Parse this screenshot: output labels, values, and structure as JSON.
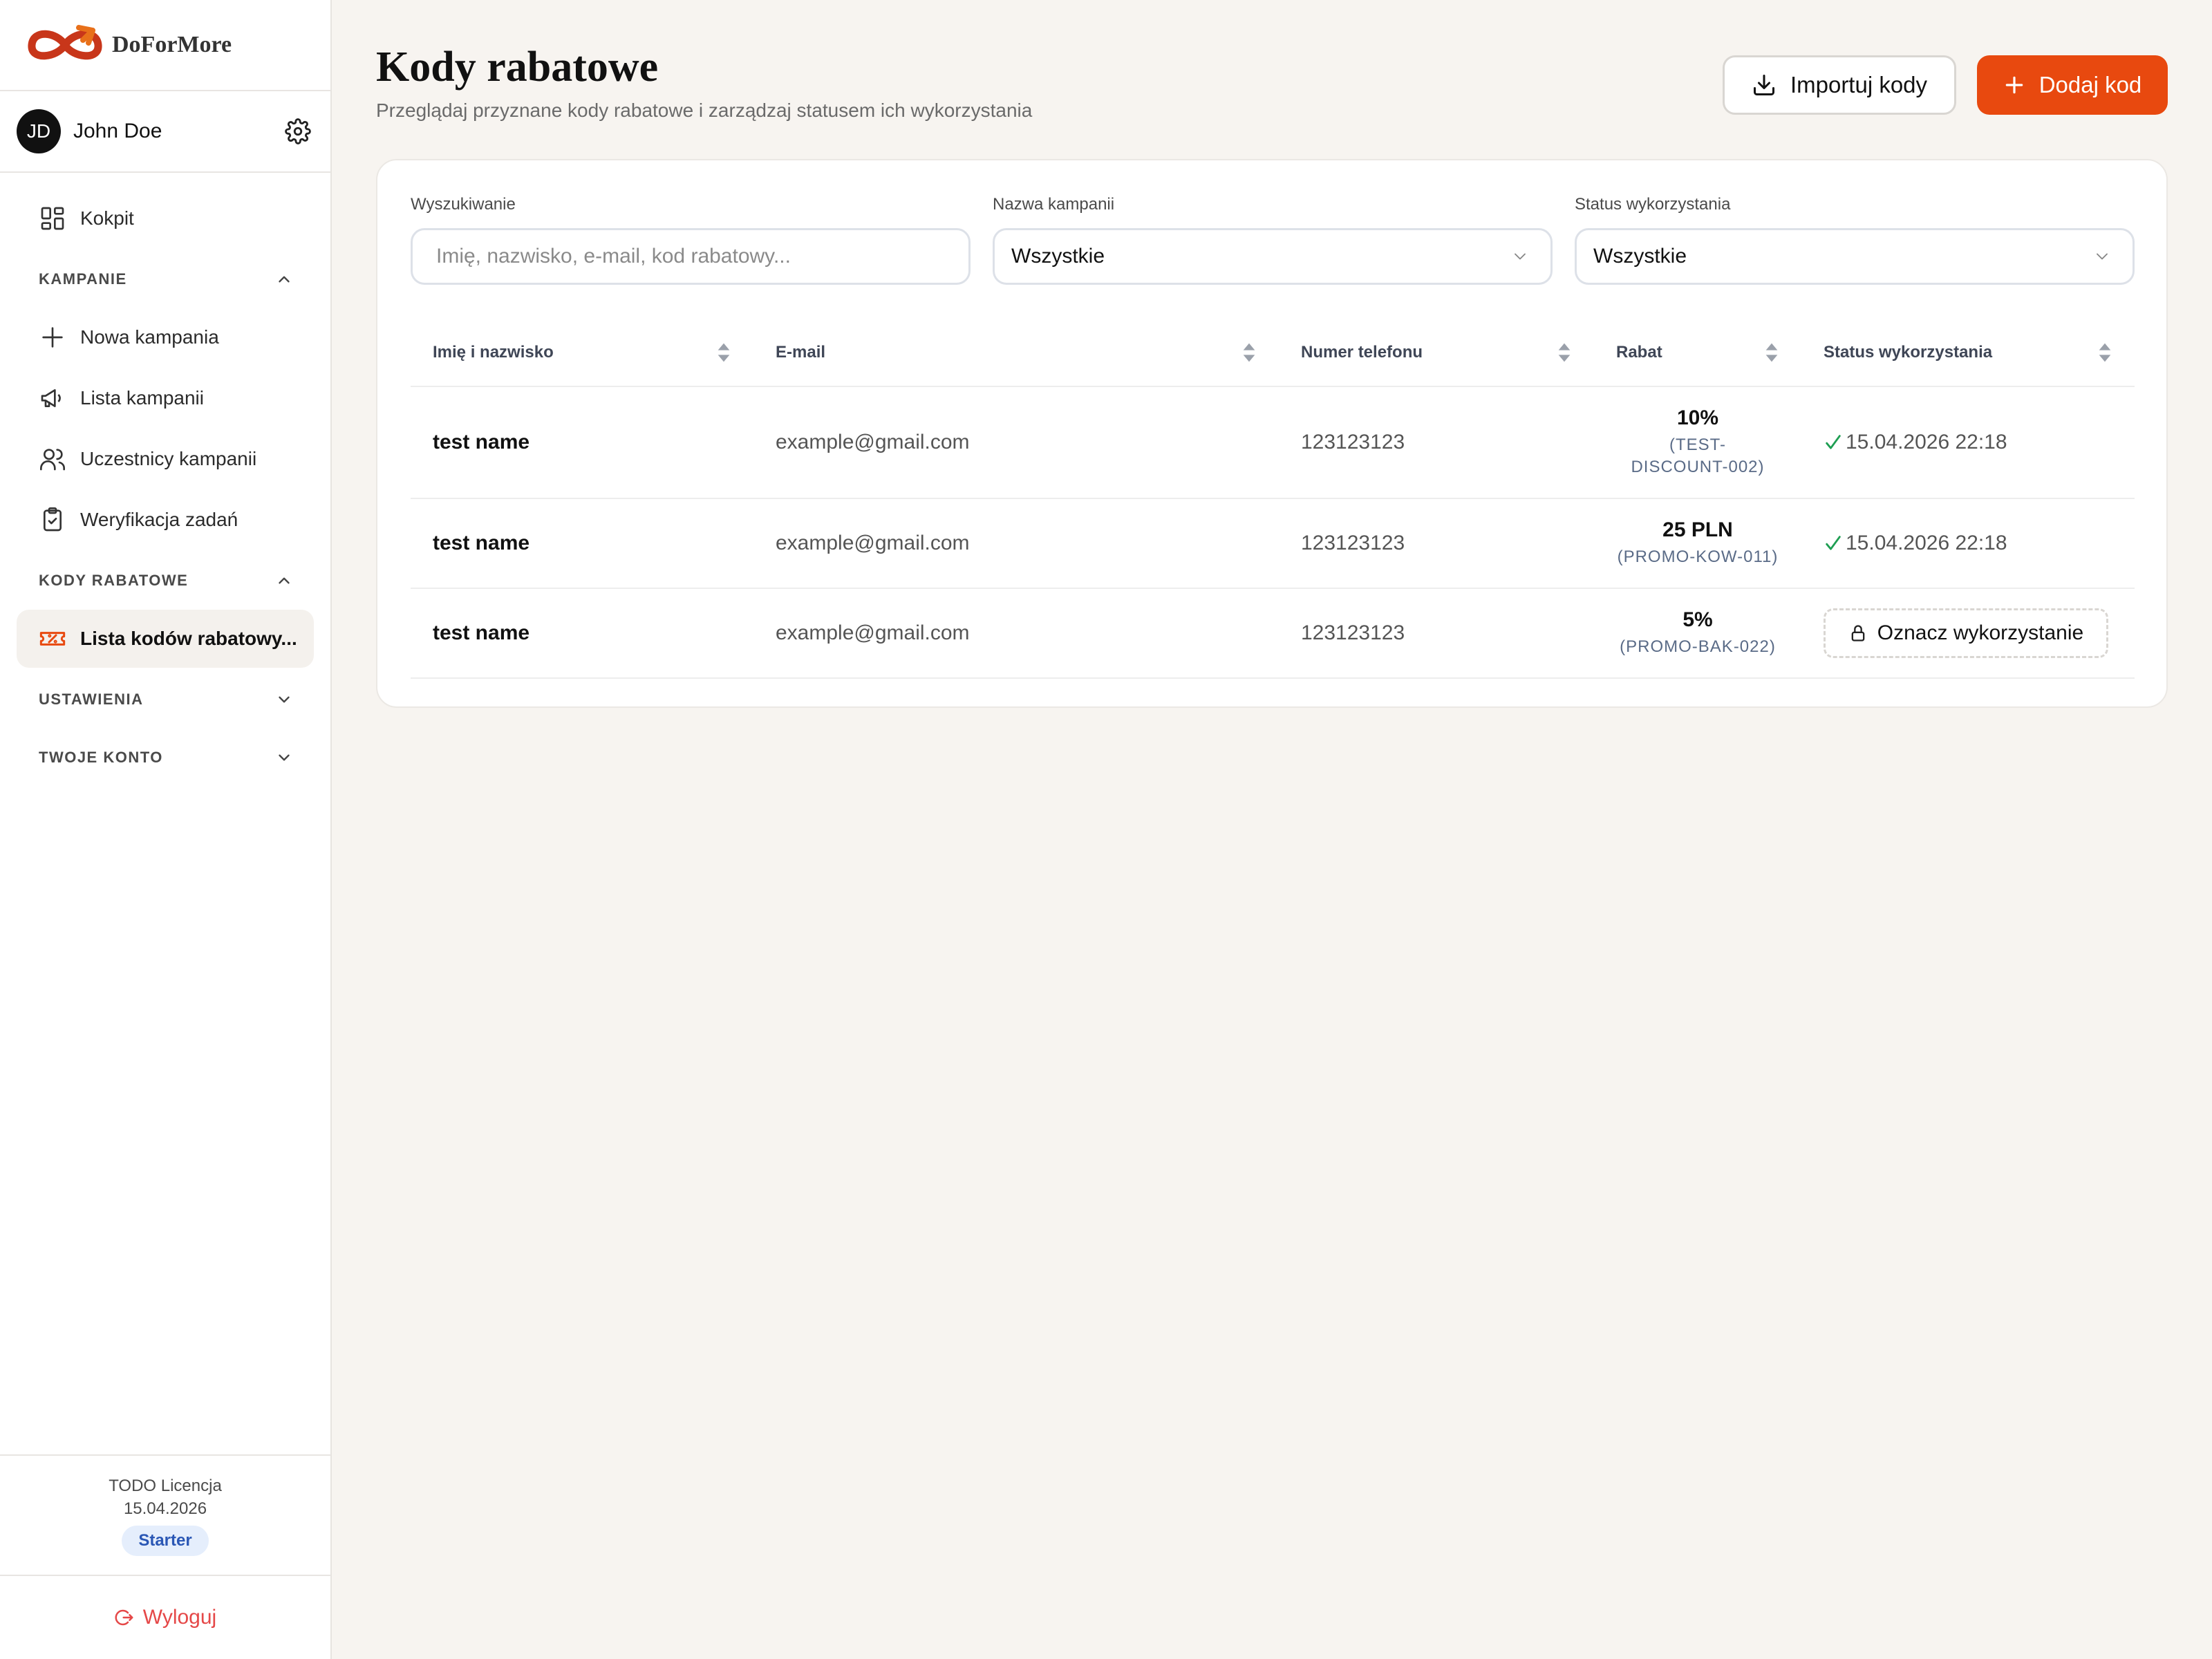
{
  "app": {
    "brand": "DoForMore"
  },
  "user": {
    "initials": "JD",
    "name": "John Doe"
  },
  "nav": {
    "dashboard": "Kokpit",
    "campaigns_section": "KAMPANIE",
    "new_campaign": "Nowa kampania",
    "campaign_list": "Lista kampanii",
    "participants": "Uczestnicy kampanii",
    "task_verification": "Weryfikacja zadań",
    "codes_section": "KODY RABATOWE",
    "codes_list": "Lista kodów rabatowy...",
    "settings_section": "USTAWIENIA",
    "account_section": "TWOJE KONTO"
  },
  "footer": {
    "license_name": "TODO Licencja",
    "license_date": "15.04.2026",
    "plan": "Starter",
    "logout": "Wyloguj"
  },
  "header": {
    "title": "Kody rabatowe",
    "subtitle": "Przeglądaj przyznane kody rabatowe i zarządzaj statusem ich wykorzystania",
    "import_label": "Importuj kody",
    "add_label": "Dodaj kod"
  },
  "filters": {
    "search_label": "Wyszukiwanie",
    "search_placeholder": "Imię, nazwisko, e-mail, kod rabatowy...",
    "campaign_label": "Nazwa kampanii",
    "campaign_value": "Wszystkie",
    "status_label": "Status wykorzystania",
    "status_value": "Wszystkie"
  },
  "table": {
    "columns": [
      "Imię i nazwisko",
      "E-mail",
      "Numer telefonu",
      "Rabat",
      "Status wykorzystania"
    ],
    "rows": [
      {
        "name": "test name",
        "email": "example@gmail.com",
        "phone": "123123123",
        "discount": "10%",
        "code_line1": "(TEST-",
        "code_line2": "DISCOUNT-002)",
        "status": "15.04.2026 22:18"
      },
      {
        "name": "test name",
        "email": "example@gmail.com",
        "phone": "123123123",
        "discount": "25 PLN",
        "code_line1": "(PROMO-KOW-011)",
        "status": "15.04.2026 22:18"
      },
      {
        "name": "test name",
        "email": "example@gmail.com",
        "phone": "123123123",
        "discount": "5%",
        "code_line1": "(PROMO-BAK-022)",
        "action": "Oznacz wykorzystanie"
      }
    ]
  },
  "colors": {
    "accent": "#e8490f",
    "success": "#1e9e52",
    "danger": "#e54848",
    "badge_bg": "#e5eefc"
  },
  "icons": {
    "dashboard": "grid-icon",
    "new_campaign": "plus-icon",
    "campaign_list": "megaphone-icon",
    "participants": "users-icon",
    "task_verification": "clipboard-check-icon",
    "codes_list": "ticket-icon",
    "settings": "gear-icon",
    "import": "download-icon",
    "add": "plus-icon",
    "sort": "sort-icon",
    "check": "check-icon",
    "lock": "lock-icon",
    "logout": "logout-icon",
    "chevron": "chevron-icon"
  }
}
